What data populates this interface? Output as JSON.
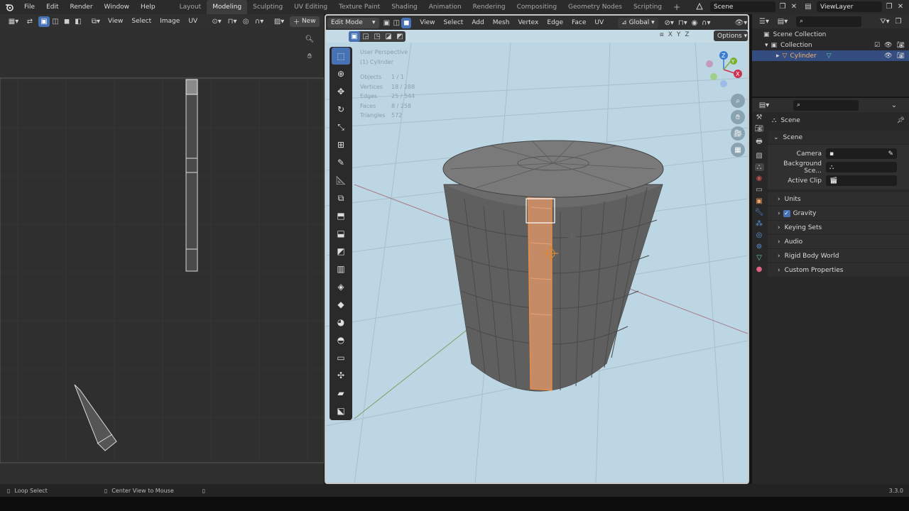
{
  "topbar": {
    "menus": [
      "File",
      "Edit",
      "Render",
      "Window",
      "Help"
    ],
    "workspaces": [
      "Layout",
      "Modeling",
      "Sculpting",
      "UV Editing",
      "Texture Paint",
      "Shading",
      "Animation",
      "Rendering",
      "Compositing",
      "Geometry Nodes",
      "Scripting"
    ],
    "active_workspace": "Modeling",
    "add_workspace": "+",
    "scene": "Scene",
    "view_layer": "ViewLayer"
  },
  "uv_editor": {
    "menus": [
      "View",
      "Select",
      "Image",
      "UV"
    ],
    "new_label": "New"
  },
  "viewport": {
    "mode": "Edit Mode",
    "menus": [
      "View",
      "Select",
      "Add",
      "Mesh",
      "Vertex",
      "Edge",
      "Face",
      "UV"
    ],
    "orientation": "Global",
    "axes": [
      "X",
      "Y",
      "Z"
    ],
    "options_label": "Options",
    "overlay": {
      "perspective": "User Perspective",
      "object": "(1) Cylinder",
      "stats": [
        {
          "label": "Objects",
          "value": "1 / 1"
        },
        {
          "label": "Vertices",
          "value": "18 / 288"
        },
        {
          "label": "Edges",
          "value": "25 / 544"
        },
        {
          "label": "Faces",
          "value": "8 / 258"
        },
        {
          "label": "Triangles",
          "value": "572"
        }
      ]
    },
    "gizmo": {
      "x": "X",
      "y": "Y",
      "z": "Z"
    }
  },
  "outliner": {
    "root": "Scene Collection",
    "collection": "Collection",
    "object": "Cylinder"
  },
  "properties": {
    "context": "Scene",
    "panel": "Scene",
    "fields": [
      {
        "label": "Camera",
        "value": ""
      },
      {
        "label": "Background Sce...",
        "value": ""
      },
      {
        "label": "Active Clip",
        "value": ""
      }
    ],
    "subpanels": [
      "Units",
      "Gravity",
      "Keying Sets",
      "Audio",
      "Rigid Body World",
      "Custom Properties"
    ],
    "gravity_checked": true
  },
  "statusbar": {
    "left": "Loop Select",
    "middle": "Center View to Mouse",
    "version": "3.3.0"
  },
  "colors": {
    "accent": "#4772b3",
    "selection_orange": "#f58f3a",
    "viewport_bg": "#bcd6e4"
  }
}
